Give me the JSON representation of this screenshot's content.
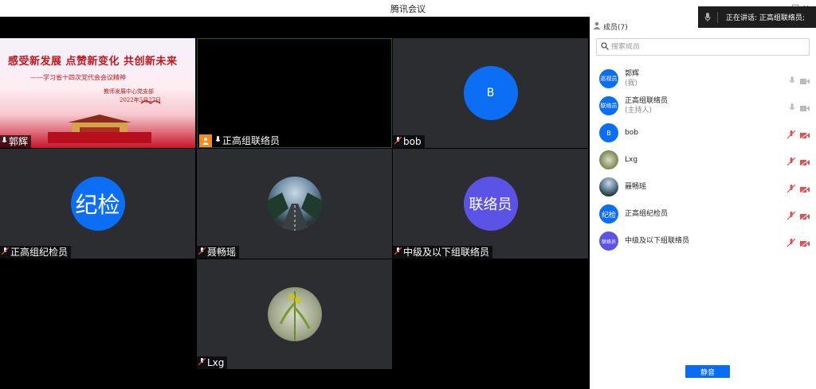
{
  "window": {
    "title": "腾讯会议",
    "controls": "□ ×"
  },
  "speaking": {
    "text": "正在讲话: 正高组联络员;"
  },
  "tiles": [
    {
      "name": "郭辉",
      "banner": {
        "line1": "感受新发展 点赞新变化 共创新未来",
        "line2": "——学习省十四次党代会会议精神",
        "line3": "教师发展中心党支部",
        "line4": "2022年5月27日"
      }
    },
    {
      "name": "正高组联络员"
    },
    {
      "name": "bob",
      "avatar_text": "B"
    },
    {
      "name": "正高组纪检员",
      "avatar_text": "纪检"
    },
    {
      "name": "聂畅瑶"
    },
    {
      "name": "中级及以下组联络员",
      "avatar_text": "联络员"
    },
    {
      "name": "Lxg"
    }
  ],
  "sidebar": {
    "header": "成员(7)",
    "search_placeholder": "搜索成员",
    "members": [
      {
        "name": "郭辉",
        "sub": "(我)",
        "avatar": "巡视员",
        "muted": false
      },
      {
        "name": "正高组联络员",
        "sub": "(主持人)",
        "avatar": "联络员",
        "muted": false
      },
      {
        "name": "bob",
        "sub": "",
        "avatar": "B",
        "muted": true
      },
      {
        "name": "Lxg",
        "sub": "",
        "avatar": "",
        "muted": true
      },
      {
        "name": "聂畅瑶",
        "sub": "",
        "avatar": "",
        "muted": true
      },
      {
        "name": "正高组纪检员",
        "sub": "",
        "avatar": "纪检",
        "muted": true
      },
      {
        "name": "中级及以下组联络员",
        "sub": "",
        "avatar": "联络员",
        "muted": true
      }
    ],
    "mute_all": "静音"
  },
  "colors": {
    "accent": "#0a6cf5",
    "tile_bg": "#2b2d31",
    "purple": "#5b53e6",
    "muted_red": "#e05050"
  }
}
